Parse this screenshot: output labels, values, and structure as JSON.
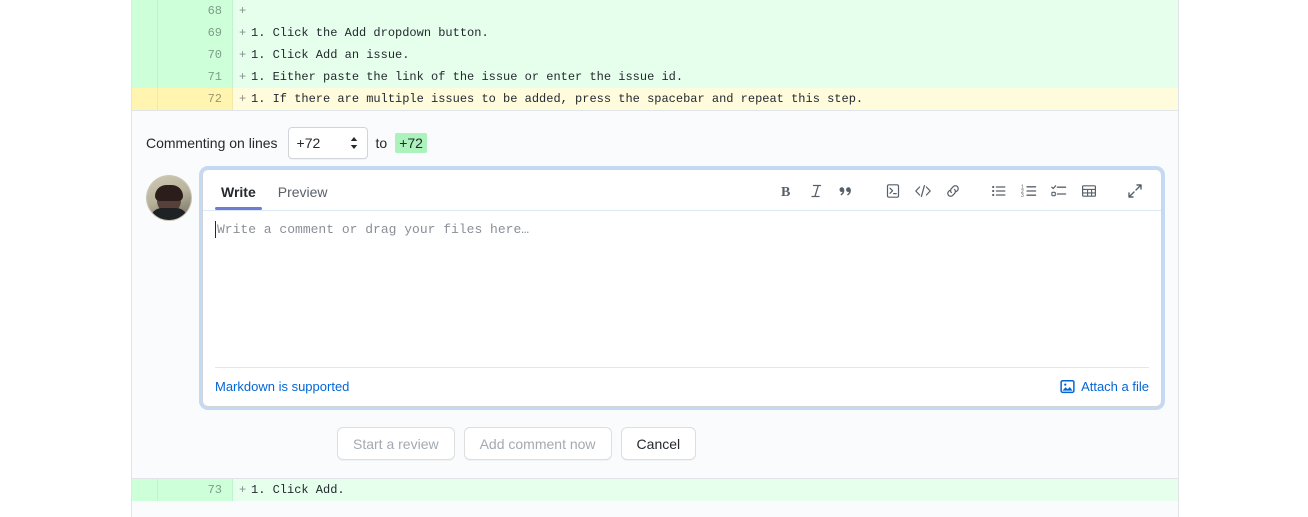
{
  "diff": {
    "rows": [
      {
        "line": "68",
        "marker": "+",
        "code": "",
        "state": "addition"
      },
      {
        "line": "69",
        "marker": "+",
        "code": "1. Click the Add dropdown button.",
        "state": "addition"
      },
      {
        "line": "70",
        "marker": "+",
        "code": "1. Click Add an issue.",
        "state": "addition"
      },
      {
        "line": "71",
        "marker": "+",
        "code": "1. Either paste the link of the issue or enter the issue id.",
        "state": "addition"
      },
      {
        "line": "72",
        "marker": "+",
        "code": "1. If there are multiple issues to be added, press the spacebar and repeat this step.",
        "state": "selected"
      }
    ],
    "trailing_rows": [
      {
        "line": "73",
        "marker": "+",
        "code": "1. Click Add.",
        "state": "addition"
      }
    ]
  },
  "commenting_on": {
    "label": "Commenting on lines",
    "start_line_value": "+72",
    "to_word": "to",
    "end_line_value": "+72"
  },
  "avatar": {
    "name": "user-avatar"
  },
  "editor": {
    "tabs": [
      {
        "label": "Write",
        "active": true
      },
      {
        "label": "Preview",
        "active": false
      }
    ],
    "toolbar": [
      {
        "name": "bold-icon",
        "title": "Bold"
      },
      {
        "name": "italic-icon",
        "title": "Italic"
      },
      {
        "name": "quote-icon",
        "title": "Insert a quote"
      },
      {
        "name": "heading-script-icon",
        "title": "Add heading text"
      },
      {
        "name": "code-icon",
        "title": "Insert code"
      },
      {
        "name": "link-icon",
        "title": "Add a link"
      },
      {
        "name": "unordered-list-icon",
        "title": "Add a bulleted list"
      },
      {
        "name": "ordered-list-icon",
        "title": "Add a numbered list"
      },
      {
        "name": "task-list-icon",
        "title": "Add a task list"
      },
      {
        "name": "table-icon",
        "title": "Add a table"
      },
      {
        "name": "fullscreen-icon",
        "title": "Zen mode"
      }
    ],
    "placeholder": "Write a comment or drag your files here…",
    "value": "",
    "markdown_note": "Markdown is supported",
    "attach_label": "Attach a file"
  },
  "actions": [
    {
      "label": "Start a review",
      "state": "disabled"
    },
    {
      "label": "Add comment now",
      "state": "disabled"
    },
    {
      "label": "Cancel",
      "state": "normal"
    }
  ],
  "colors": {
    "addition_bg": "#e6ffed",
    "selected_bg": "#fffbdd",
    "accent_link": "#0366d6",
    "badge_green": "#acf2bd",
    "tab_underline": "#6f7bd4"
  }
}
